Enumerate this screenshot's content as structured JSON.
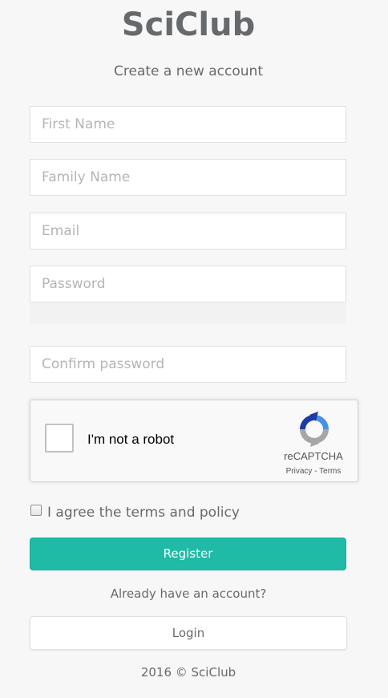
{
  "brand": "SciClub",
  "subtitle": "Create a new account",
  "form": {
    "first_name_placeholder": "First Name",
    "family_name_placeholder": "Family Name",
    "email_placeholder": "Email",
    "password_placeholder": "Password",
    "confirm_password_placeholder": "Confirm password"
  },
  "captcha": {
    "label": "I'm not a robot",
    "brand": "reCAPTCHA",
    "privacy": "Privacy",
    "separator": " - ",
    "terms": "Terms"
  },
  "agree_label": "I agree the terms and policy",
  "register_label": "Register",
  "already_text": "Already have an account?",
  "login_label": "Login",
  "footer": "2016 © SciClub",
  "colors": {
    "primary": "#1fbba6",
    "text": "#676a6c",
    "background": "#f7f7f7"
  }
}
